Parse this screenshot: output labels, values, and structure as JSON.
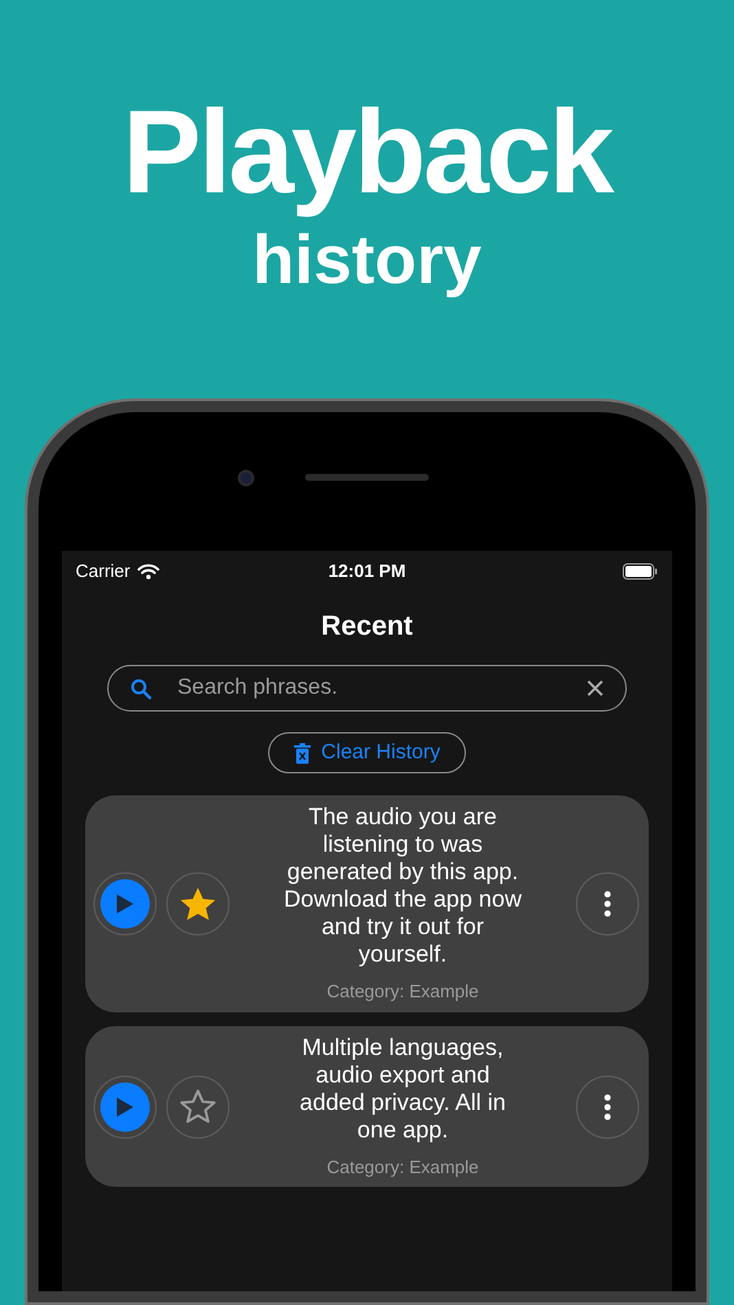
{
  "headline": {
    "title": "Playback",
    "subtitle": "history"
  },
  "status_bar": {
    "carrier": "Carrier",
    "time": "12:01 PM"
  },
  "screen_title": "Recent",
  "search": {
    "placeholder": "Search phrases."
  },
  "clear_button": "Clear History",
  "items": [
    {
      "text": "The audio you are listening to was generated by this app. Download the app now and try it out for yourself.",
      "category": "Category: Example",
      "favorite": true
    },
    {
      "text": "Multiple languages, audio export and added privacy. All in one app.",
      "category": "Category: Example",
      "favorite": false
    }
  ]
}
